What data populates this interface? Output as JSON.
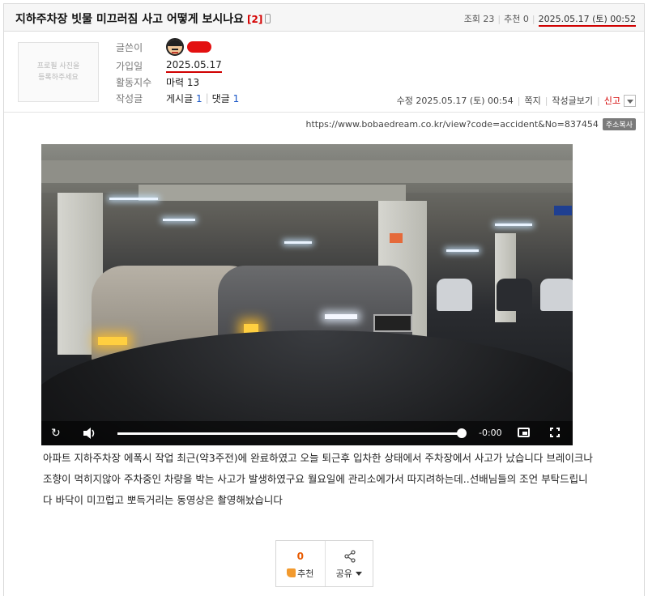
{
  "post": {
    "title": "지하주차장 빗물 미끄러짐 사고 어떻게 보시나요",
    "comment_count": "[2]",
    "views": "조회 23",
    "recommends": "추천 0",
    "datetime": "2025.05.17 (토) 00:52"
  },
  "author": {
    "profile_placeholder_line1": "프로필 사진을",
    "profile_placeholder_line2": "등록하주세요",
    "label_writer": "글쓴이",
    "label_joined": "가입일",
    "joined": "2025.05.17",
    "label_activity": "활동지수",
    "activity": "마력 13",
    "label_posts": "작성글",
    "posts_label": "게시글",
    "posts_count": "1",
    "comments_label": "댓글",
    "comments_count": "1"
  },
  "edit_bar": {
    "modified": "수정 2025.05.17 (토) 00:54",
    "message": "쪽지",
    "view_posts": "작성글보기",
    "report": "신고"
  },
  "url_bar": {
    "url": "https://www.bobaedream.co.kr/view?code=accident&No=837454",
    "copy_label": "주소복사"
  },
  "video": {
    "time": "-0:00",
    "progress": 1.0
  },
  "content": {
    "line1": "아파트 지하주차장 에폭시 작업 최근(약3주전)에 완료하였고 오늘 퇴근후 입차한 상태에서 주차장에서 사고가 났습니다 브레이크나",
    "line2": "조향이 먹히지않아 주차중인 차량을 박는 사고가 발생하였구요 월요일에 관리소에가서 따지려하는데..선배님들의 조언 부탁드립니",
    "line3": "다 바닥이 미끄럽고 뽀득거리는 동영상은 촬영해놨습니다"
  },
  "actions": {
    "recommend_count": "0",
    "recommend_label": "추천",
    "share_label": "공유"
  },
  "colors": {
    "highlight_red": "#d00000",
    "recommend_orange": "#e85a00",
    "link_blue": "#1a57c7"
  }
}
